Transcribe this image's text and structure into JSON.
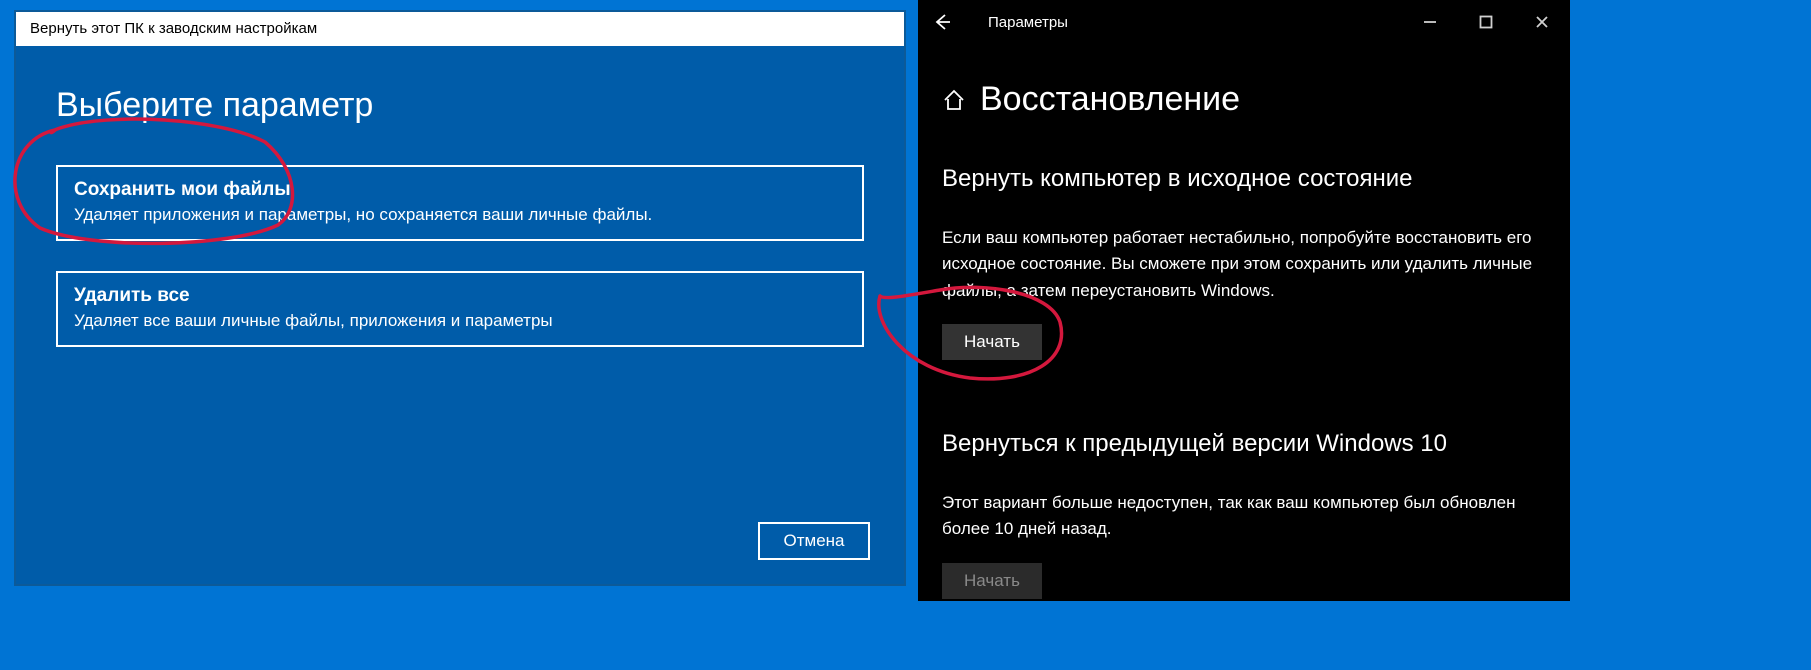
{
  "reset_dialog": {
    "title": "Вернуть этот ПК к заводским настройкам",
    "heading": "Выберите параметр",
    "option1": {
      "title": "Сохранить мои файлы",
      "desc": "Удаляет приложения и параметры, но сохраняется ваши личные файлы."
    },
    "option2": {
      "title": "Удалить все",
      "desc": "Удаляет все ваши личные файлы, приложения и параметры"
    },
    "cancel": "Отмена"
  },
  "settings": {
    "titlebar": "Параметры",
    "page_title": "Восстановление",
    "section1": {
      "heading": "Вернуть компьютер в исходное состояние",
      "text": "Если ваш компьютер работает нестабильно, попробуйте восстановить его исходное состояние. Вы сможете при этом сохранить или удалить личные файлы, а затем переустановить Windows.",
      "button": "Начать"
    },
    "section2": {
      "heading": "Вернуться к предыдущей версии Windows 10",
      "text": "Этот вариант больше недоступен, так как ваш компьютер был обновлен более 10 дней назад.",
      "button": "Начать"
    }
  }
}
